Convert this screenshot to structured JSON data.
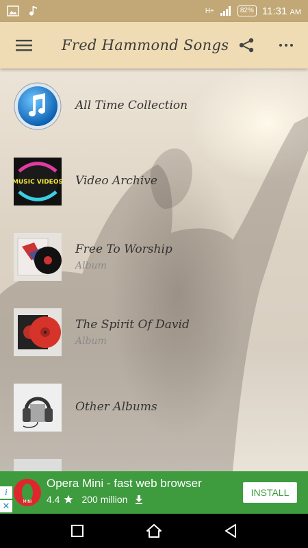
{
  "status_bar": {
    "network": "H+",
    "battery": "82%",
    "time": "11:31",
    "ampm": "AM"
  },
  "app_bar": {
    "title": "Fred Hammond Songs",
    "icons": [
      "menu-icon",
      "share-icon",
      "more-vert-icon"
    ]
  },
  "list": {
    "items": [
      {
        "title": "All Time Collection",
        "subtitle": "",
        "icon": "music-note-icon"
      },
      {
        "title": "Video Archive",
        "subtitle": "",
        "icon": "music-videos-icon",
        "thumb_text": "MUSIC VIDEOS"
      },
      {
        "title": "Free To Worship",
        "subtitle": "Album",
        "icon": "vinyl-record-icon"
      },
      {
        "title": "The Spirit Of David",
        "subtitle": "Album",
        "icon": "red-vinyl-icon"
      },
      {
        "title": "Other Albums",
        "subtitle": "",
        "icon": "headphones-icon"
      }
    ]
  },
  "ad": {
    "title": "Opera Mini - fast web browser",
    "rating": "4.4",
    "downloads": "200 million",
    "install_label": "INSTALL",
    "icons": [
      "info-icon",
      "close-icon",
      "opera-logo-icon",
      "star-icon",
      "download-icon"
    ],
    "colors": {
      "background": "#3e9b3e",
      "logo": "#e0262d"
    }
  },
  "nav": {
    "icons": [
      "recents-square-icon",
      "home-triangle-icon",
      "back-triangle-icon"
    ]
  },
  "colors": {
    "status_bar": "#c2a876",
    "app_bar": "#efdcb4",
    "ad": "#3e9b3e"
  }
}
